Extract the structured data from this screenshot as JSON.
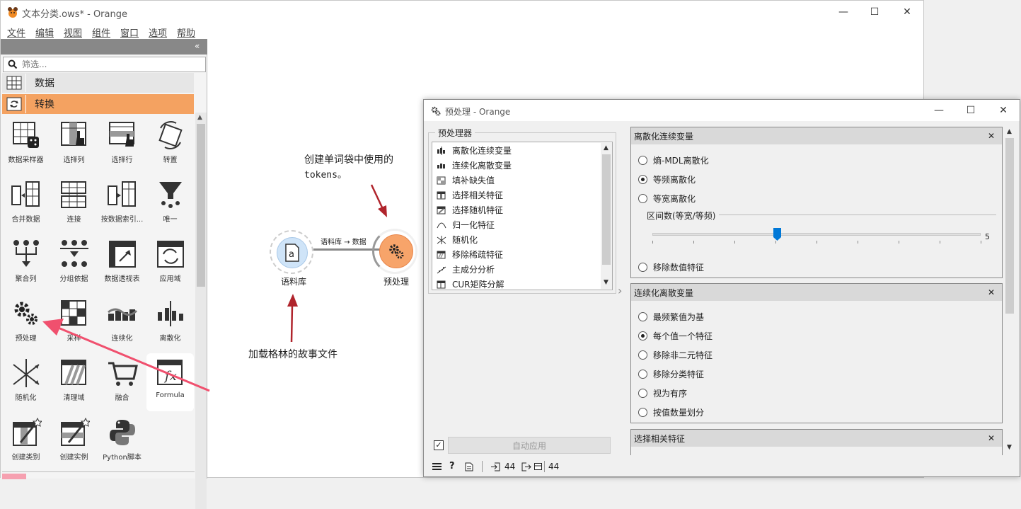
{
  "window": {
    "title": "文本分类.ows* - Orange",
    "minimize": "—",
    "maximize": "☐",
    "close": "✕"
  },
  "menu": [
    "文件",
    "编辑",
    "视图",
    "组件",
    "窗口",
    "选项",
    "帮助"
  ],
  "panel": {
    "collapse": "«",
    "filter_placeholder": "筛选...",
    "categories": [
      {
        "label": "数据"
      },
      {
        "label": "转换",
        "color": "#f4a261"
      }
    ],
    "widgets": [
      "数据采样器",
      "选择列",
      "选择行",
      "转置",
      "合并数据",
      "连接",
      "按数据索引...",
      "唯一",
      "聚合列",
      "分组依据",
      "数据透视表",
      "应用域",
      "预处理",
      "采样",
      "连续化",
      "离散化",
      "随机化",
      "清理域",
      "融合",
      "Formula",
      "创建类别",
      "创建实例",
      "Python脚本"
    ]
  },
  "canvas": {
    "node_corpus": "语料库",
    "node_preprocess": "预处理",
    "link_label": "语料库 → 数据",
    "annotation_top_line1": "创建单词袋中使用的",
    "annotation_top_line2": "tokens。",
    "annotation_bottom": "加载格林的故事文件"
  },
  "preprocess": {
    "title": "预处理 - Orange",
    "preprocessors_label": "预处理器",
    "list": [
      "离散化连续变量",
      "连续化离散变量",
      "填补缺失值",
      "选择相关特征",
      "选择随机特征",
      "归一化特征",
      "随机化",
      "移除稀疏特征",
      "主成分分析",
      "CUR矩阵分解"
    ],
    "discretize": {
      "title": "离散化连续变量",
      "options": [
        "熵-MDL离散化",
        "等频离散化",
        "等宽离散化"
      ],
      "selected": 1,
      "interval_label": "区间数(等宽/等频)",
      "interval_value": "5",
      "slider_fraction": 0.38,
      "remove_option": "移除数值特征"
    },
    "continuize": {
      "title": "连续化离散变量",
      "options": [
        "最频繁值为基",
        "每个值一个特征",
        "移除非二元特征",
        "移除分类特征",
        "视为有序",
        "按值数量划分"
      ],
      "selected": 1
    },
    "select_relevant": {
      "title": "选择相关特征"
    },
    "auto_apply": "自动应用",
    "status_in": "44",
    "status_out": "44",
    "close_glyph": "✕"
  },
  "colors": {
    "accent": "#f4a261",
    "arrow_red": "#b0242c",
    "pink_arrow": "#f0506e"
  }
}
